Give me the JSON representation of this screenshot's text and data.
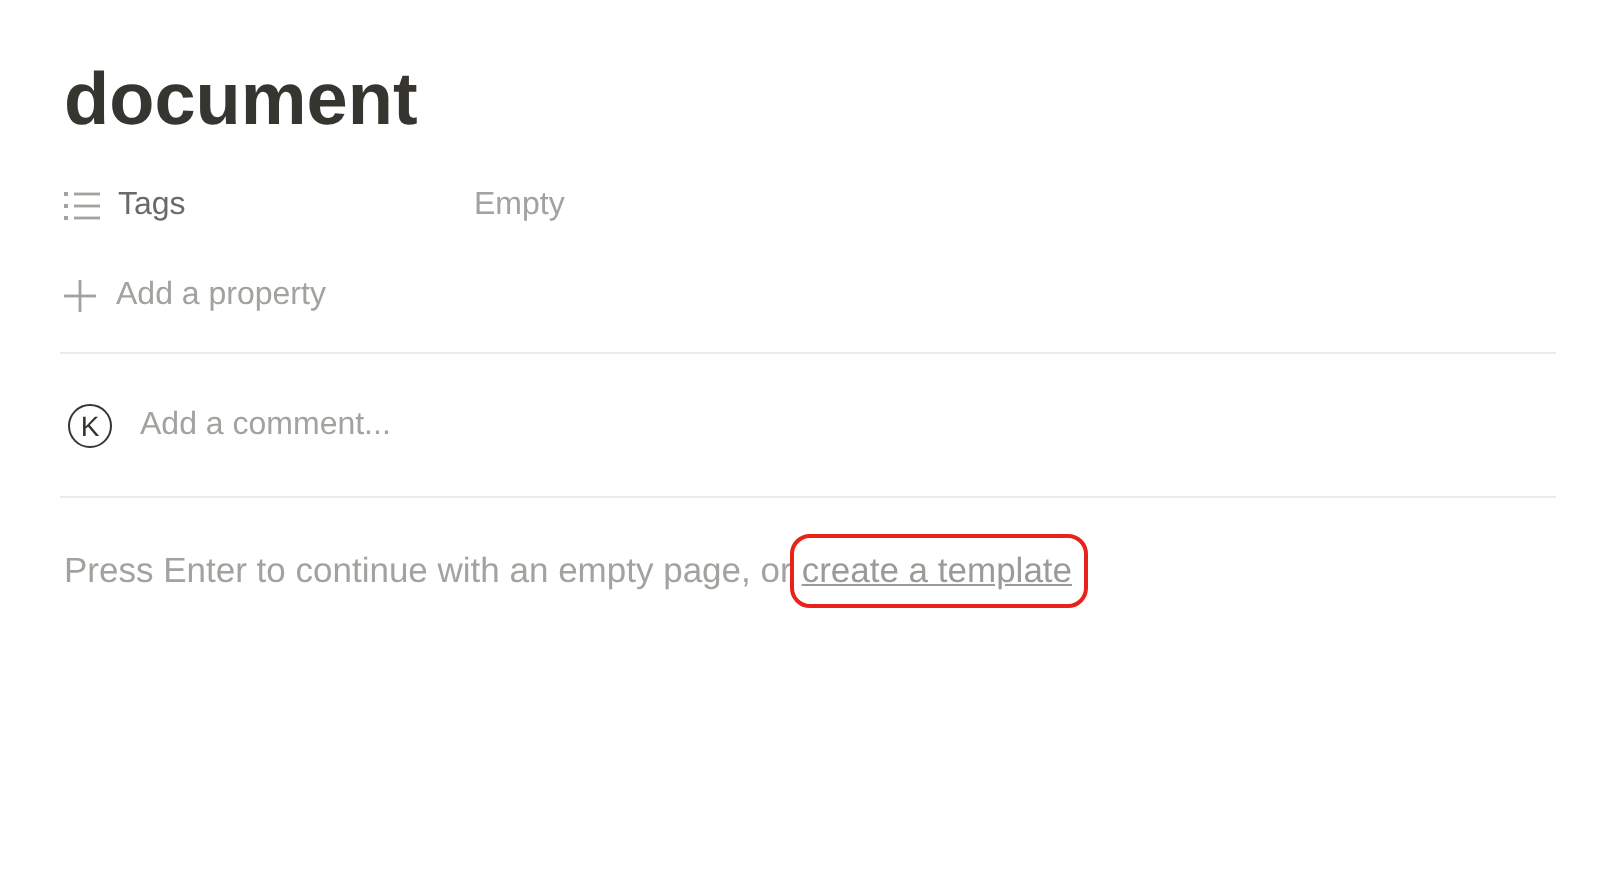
{
  "title": "document",
  "properties": [
    {
      "kind": "list",
      "name": "Tags",
      "value": "Empty"
    }
  ],
  "add_property": {
    "label": "Add a property"
  },
  "comment": {
    "avatar": "K",
    "placeholder": "Add a comment..."
  },
  "hint": {
    "text": "Press Enter to continue with an empty page, or",
    "link": "create a template",
    "highlighted": true
  }
}
